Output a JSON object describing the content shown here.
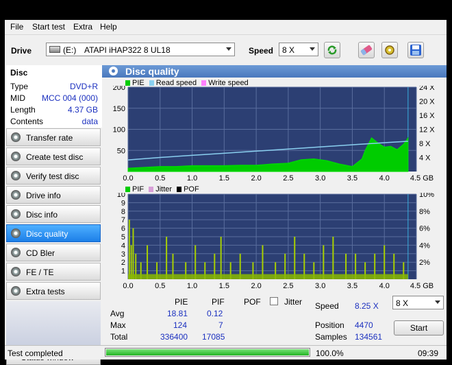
{
  "menu": [
    "File",
    "Start test",
    "Extra",
    "Help"
  ],
  "toolbar": {
    "drive_label": "Drive",
    "drive_letter": "(E:)",
    "drive_name": "ATAPI iHAP322  8 UL18",
    "speed_label": "Speed",
    "speed_value": "8 X"
  },
  "disc": {
    "header": "Disc",
    "rows": [
      {
        "key": "Type",
        "value": "DVD+R"
      },
      {
        "key": "MID",
        "value": "MCC 004 (000)"
      },
      {
        "key": "Length",
        "value": "4.37 GB"
      },
      {
        "key": "Contents",
        "value": "data"
      }
    ]
  },
  "nav": [
    {
      "label": "Transfer rate",
      "active": false
    },
    {
      "label": "Create test disc",
      "active": false
    },
    {
      "label": "Verify test disc",
      "active": false
    },
    {
      "label": "Drive info",
      "active": false
    },
    {
      "label": "Disc info",
      "active": false
    },
    {
      "label": "Disc quality",
      "active": true
    },
    {
      "label": "CD Bler",
      "active": false
    },
    {
      "label": "FE / TE",
      "active": false
    },
    {
      "label": "Extra tests",
      "active": false
    }
  ],
  "status_window_label": "Status window >>",
  "panel_title": "Disc quality",
  "chart_data": [
    {
      "type": "area",
      "legend": [
        "PIE",
        "Read speed",
        "Write speed"
      ],
      "colors": {
        "PIE": "#00cc00",
        "Read speed": "#8ad0f0",
        "Write speed": "#ff80ff"
      },
      "x_ticks": [
        "0.0",
        "0.5",
        "1.0",
        "1.5",
        "2.0",
        "2.5",
        "3.0",
        "3.5",
        "4.0",
        "4.5 GB"
      ],
      "y_ticks_left": [
        "200",
        "150",
        "100",
        "50"
      ],
      "y_ticks_right": [
        "24 X",
        "20 X",
        "16 X",
        "12 X",
        "8 X",
        "4 X"
      ],
      "xlim": [
        0,
        4.5
      ],
      "ylim": [
        0,
        200
      ],
      "series": [
        {
          "name": "PIE",
          "x": [
            0,
            0.25,
            0.5,
            0.75,
            1.0,
            1.25,
            1.5,
            1.75,
            2.0,
            2.25,
            2.5,
            2.7,
            2.9,
            3.1,
            3.3,
            3.5,
            3.65,
            3.7,
            3.8,
            3.9,
            4.0,
            4.1,
            4.2,
            4.3,
            4.37
          ],
          "values": [
            8,
            10,
            12,
            12,
            14,
            14,
            14,
            15,
            15,
            18,
            20,
            28,
            30,
            26,
            18,
            12,
            30,
            50,
            80,
            68,
            58,
            60,
            52,
            65,
            80
          ]
        },
        {
          "name": "Read speed",
          "x": [
            0,
            0.5,
            1.0,
            1.5,
            2.0,
            2.5,
            3.0,
            3.5,
            4.0,
            4.37
          ],
          "values": [
            3.3,
            4.0,
            4.6,
            5.2,
            5.8,
            6.4,
            7.0,
            7.6,
            8.2,
            8.6
          ]
        }
      ],
      "y2lim": [
        0,
        24
      ]
    },
    {
      "type": "bar",
      "legend": [
        "PIF",
        "Jitter",
        "POF"
      ],
      "colors": {
        "PIF": "#00cc00",
        "Jitter": "#d8a0d8",
        "POF": "#000000"
      },
      "x_ticks": [
        "0.0",
        "0.5",
        "1.0",
        "1.5",
        "2.0",
        "2.5",
        "3.0",
        "3.5",
        "4.0",
        "4.5 GB"
      ],
      "y_ticks_left": [
        "10",
        "9",
        "8",
        "7",
        "6",
        "5",
        "4",
        "3",
        "2",
        "1"
      ],
      "y_ticks_right": [
        "10%",
        "8%",
        "6%",
        "4%",
        "2%"
      ],
      "xlim": [
        0,
        4.5
      ],
      "ylim": [
        0,
        10
      ],
      "series": [
        {
          "name": "PIF",
          "x": [
            0.02,
            0.05,
            0.08,
            0.12,
            0.2,
            0.3,
            0.45,
            0.6,
            0.7,
            0.9,
            1.05,
            1.2,
            1.35,
            1.45,
            1.6,
            1.75,
            1.95,
            2.1,
            2.3,
            2.45,
            2.6,
            2.75,
            2.9,
            3.05,
            3.2,
            3.4,
            3.55,
            3.7,
            3.85,
            4.0,
            4.15,
            4.3
          ],
          "values": [
            7,
            4,
            6,
            3,
            2,
            4,
            2,
            5,
            3,
            2,
            4,
            2,
            3,
            5,
            2,
            3,
            2,
            4,
            2,
            3,
            5,
            3,
            2,
            4,
            5,
            3,
            3,
            2,
            3,
            4,
            3,
            2
          ]
        }
      ]
    }
  ],
  "stats": {
    "col_pie": "PIE",
    "col_pif": "PIF",
    "col_pof": "POF",
    "jitter_label": "Jitter",
    "avg_label": "Avg",
    "avg_pie": "18.81",
    "avg_pif": "0.12",
    "max_label": "Max",
    "max_pie": "124",
    "max_pif": "7",
    "total_label": "Total",
    "total_pie": "336400",
    "total_pif": "17085",
    "speed_label": "Speed",
    "speed_value": "8.25 X",
    "speed_select": "8 X",
    "position_label": "Position",
    "position_value": "4470",
    "samples_label": "Samples",
    "samples_value": "134561",
    "start_label": "Start"
  },
  "statusbar": {
    "text": "Test completed",
    "progress": 1.0,
    "percent": "100.0%",
    "time": "09:39"
  }
}
